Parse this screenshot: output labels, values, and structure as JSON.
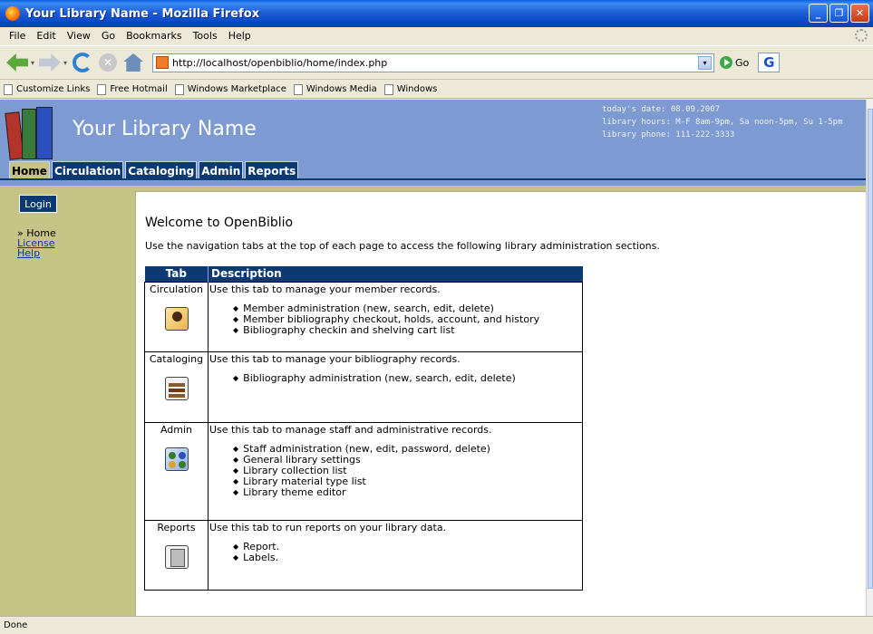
{
  "window": {
    "title": "Your Library Name - Mozilla Firefox"
  },
  "menu": [
    "File",
    "Edit",
    "View",
    "Go",
    "Bookmarks",
    "Tools",
    "Help"
  ],
  "navbar": {
    "url": "http://localhost/openbiblio/home/index.php",
    "go_label": "Go",
    "search_engine_glyph": "G"
  },
  "bookmarks": [
    "Customize Links",
    "Free Hotmail",
    "Windows Marketplace",
    "Windows Media",
    "Windows"
  ],
  "header": {
    "library_name": "Your Library Name",
    "date_line": "today's date:  08.09.2007",
    "hours_line": "library hours:  M-F 8am-9pm, Sa noon-5pm, Su 1-5pm",
    "phone_line": "library phone: 111-222-3333"
  },
  "tabs": [
    "Home",
    "Circulation",
    "Cataloging",
    "Admin",
    "Reports"
  ],
  "sidebar": {
    "login_label": "Login",
    "home_label": "» Home",
    "license_label": "License",
    "help_label": "Help"
  },
  "main": {
    "welcome": "Welcome to OpenBiblio",
    "intro": "Use the navigation tabs at the top of each page to access the following library administration sections.",
    "table_headers": {
      "tab": "Tab",
      "description": "Description"
    },
    "rows": [
      {
        "tab": "Circulation",
        "icon": "member-icon",
        "lead": "Use this tab to manage your member records.",
        "items": [
          "Member administration (new, search, edit, delete)",
          "Member bibliography checkout, holds, account, and history",
          "Bibliography checkin and shelving cart list"
        ]
      },
      {
        "tab": "Cataloging",
        "icon": "books-icon",
        "lead": "Use this tab to manage your bibliography records.",
        "items": [
          "Bibliography administration (new, search, edit, delete)"
        ]
      },
      {
        "tab": "Admin",
        "icon": "staff-icon",
        "lead": "Use this tab to manage staff and administrative records.",
        "items": [
          "Staff administration (new, edit, password, delete)",
          "General library settings",
          "Library collection list",
          "Library material type list",
          "Library theme editor"
        ]
      },
      {
        "tab": "Reports",
        "icon": "report-icon",
        "lead": "Use this tab to run reports on your library data.",
        "items": [
          "Report.",
          "Labels."
        ]
      }
    ]
  },
  "status": {
    "text": "Done"
  },
  "colors": {
    "header_bg": "#7e9ad2",
    "tab_bg": "#0b3a73",
    "sidebar_bg": "#c6c387"
  }
}
